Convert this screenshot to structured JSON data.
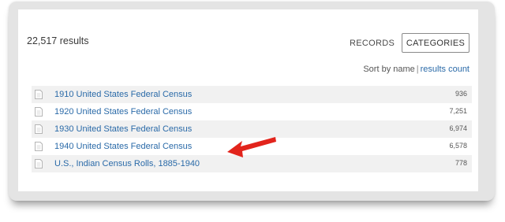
{
  "summary": {
    "results_text": "22,517 results"
  },
  "tabs": {
    "records": "RECORDS",
    "categories": "CATEGORIES"
  },
  "sort": {
    "label": "Sort by name",
    "separator": "|",
    "alt": "results count"
  },
  "rows": [
    {
      "title": "1910 United States Federal Census",
      "count": "936"
    },
    {
      "title": "1920 United States Federal Census",
      "count": "7,251"
    },
    {
      "title": "1930 United States Federal Census",
      "count": "6,974"
    },
    {
      "title": "1940 United States Federal Census",
      "count": "6,578"
    },
    {
      "title": "U.S., Indian Census Rolls, 1885-1940",
      "count": "778"
    }
  ],
  "colors": {
    "link": "#2a6aa8",
    "arrow": "#e2241c",
    "row_shade": "#f1f1f1"
  },
  "annotation": {
    "icon": "red-arrow-icon",
    "points_to": "1940 United States Federal Census"
  }
}
